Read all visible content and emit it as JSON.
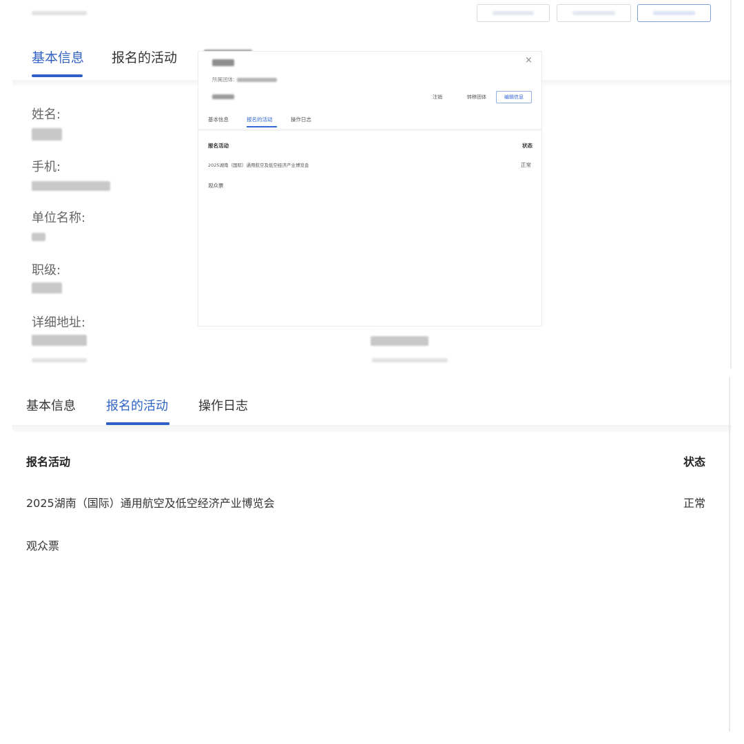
{
  "background_page": {
    "tabs": [
      {
        "label": "基本信息",
        "active": true
      },
      {
        "label": "报名的活动",
        "active": false
      }
    ],
    "fields": [
      {
        "label": "姓名:"
      },
      {
        "label": "手机:"
      },
      {
        "label": "单位名称:"
      },
      {
        "label": "职级:"
      },
      {
        "label": "详细地址:"
      }
    ]
  },
  "popup": {
    "close_icon": "×",
    "group_label": "所属团体:",
    "buttons": {
      "cancel": "注销",
      "transfer": "转移团体",
      "edit": "编辑信息"
    },
    "tabs": [
      {
        "label": "基本信息",
        "active": false
      },
      {
        "label": "报名的活动",
        "active": true
      },
      {
        "label": "操作日志",
        "active": false
      }
    ],
    "table": {
      "col_activity": "报名活动",
      "col_status": "状态",
      "rows": [
        {
          "activity": "2025湖南（国际）通用航空及低空经济产业博览会",
          "status": "正常",
          "ticket": "观众票"
        }
      ]
    }
  },
  "detail": {
    "tabs": [
      {
        "label": "基本信息",
        "active": false
      },
      {
        "label": "报名的活动",
        "active": true
      },
      {
        "label": "操作日志",
        "active": false
      }
    ],
    "table": {
      "col_activity": "报名活动",
      "col_status": "状态",
      "rows": [
        {
          "activity": "2025湖南（国际）通用航空及低空经济产业博览会",
          "status": "正常",
          "ticket": "观众票"
        }
      ]
    }
  },
  "colors": {
    "accent": "#3164c8",
    "text": "#333333",
    "muted": "#666666",
    "divider": "#f2f2f2"
  }
}
